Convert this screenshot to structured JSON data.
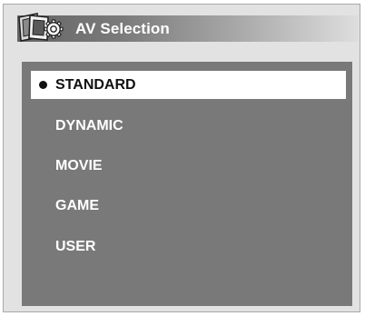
{
  "window": {
    "title": "AV Selection",
    "icon": "av-settings-gear-icon"
  },
  "menu": {
    "selected_index": 0,
    "items": [
      {
        "label": "STANDARD",
        "selected": true
      },
      {
        "label": "DYNAMIC",
        "selected": false
      },
      {
        "label": "MOVIE",
        "selected": false
      },
      {
        "label": "GAME",
        "selected": false
      },
      {
        "label": "USER",
        "selected": false
      }
    ]
  },
  "colors": {
    "panel_background": "#797979",
    "highlight_background": "#ffffff",
    "header_gradient_start": "#666666",
    "header_gradient_end": "#dedede",
    "frame_background": "#e2e2e2"
  }
}
